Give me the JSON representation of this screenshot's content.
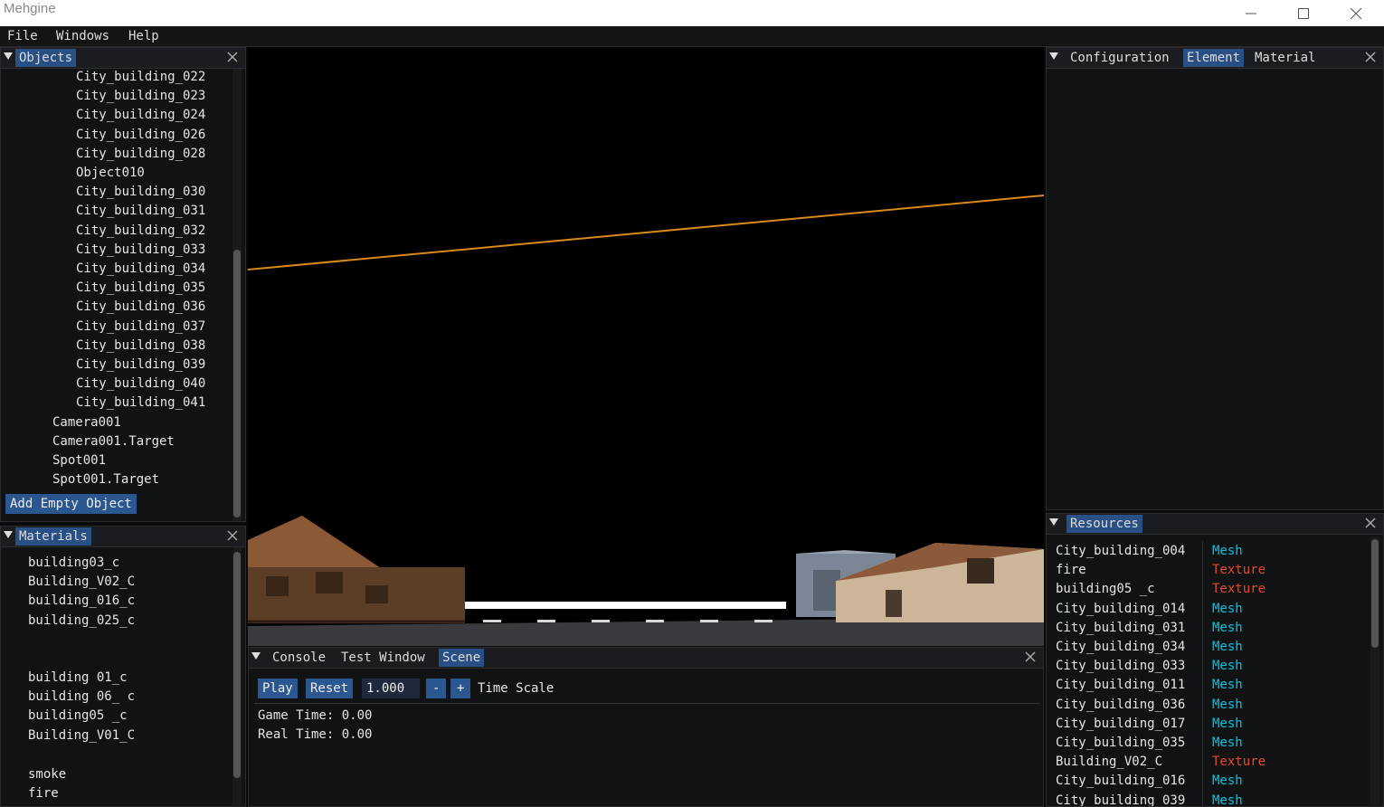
{
  "window": {
    "title": "Mehgine"
  },
  "menu": [
    "File",
    "Windows",
    "Help"
  ],
  "objects_panel": {
    "tab": "Objects",
    "items": [
      "City_building_022",
      "City_building_023",
      "City_building_024",
      "City_building_026",
      "City_building_028",
      "Object010",
      "City_building_030",
      "City_building_031",
      "City_building_032",
      "City_building_033",
      "City_building_034",
      "City_building_035",
      "City_building_036",
      "City_building_037",
      "City_building_038",
      "City_building_039",
      "City_building_040",
      "City_building_041"
    ],
    "top_items": [
      "Camera001",
      "Camera001.Target",
      "Spot001",
      "Spot001.Target"
    ],
    "add_button": "Add Empty Object"
  },
  "materials_panel": {
    "tab": "Materials",
    "group1": [
      "building03_c",
      "Building_V02_C",
      "building_016_c",
      "building_025_c"
    ],
    "group2": [
      "building 01_c",
      "building 06_ c",
      "building05 _c",
      "Building_V01_C"
    ],
    "group3": [
      "smoke",
      "fire"
    ]
  },
  "inspector_panel": {
    "tabs": [
      "Configuration",
      "Element",
      "Material"
    ],
    "active": "Element"
  },
  "console_panel": {
    "tabs": [
      "Console",
      "Test Window",
      "Scene"
    ],
    "active": "Scene",
    "play_label": "Play",
    "reset_label": "Reset",
    "time_scale_value": "1.000",
    "minus_label": "-",
    "plus_label": "+",
    "time_scale_label": "Time Scale",
    "game_time": "Game Time: 0.00",
    "real_time": "Real Time: 0.00"
  },
  "resources_panel": {
    "tab": "Resources",
    "rows": [
      {
        "name": "City_building_004",
        "type": "Mesh"
      },
      {
        "name": "fire",
        "type": "Texture"
      },
      {
        "name": "building05 _c",
        "type": "Texture"
      },
      {
        "name": "City_building_014",
        "type": "Mesh"
      },
      {
        "name": "City_building_031",
        "type": "Mesh"
      },
      {
        "name": "City_building_034",
        "type": "Mesh"
      },
      {
        "name": "City_building_033",
        "type": "Mesh"
      },
      {
        "name": "City_building_011",
        "type": "Mesh"
      },
      {
        "name": "City_building_036",
        "type": "Mesh"
      },
      {
        "name": "City_building_017",
        "type": "Mesh"
      },
      {
        "name": "City_building_035",
        "type": "Mesh"
      },
      {
        "name": "Building_V02_C",
        "type": "Texture"
      },
      {
        "name": "City_building_016",
        "type": "Mesh"
      },
      {
        "name": "City_building_039",
        "type": "Mesh"
      }
    ]
  },
  "colors": {
    "accent": "#295085",
    "mesh": "#00c8e6",
    "texture": "#e24a2a",
    "ground_line": "#d88a1a"
  }
}
